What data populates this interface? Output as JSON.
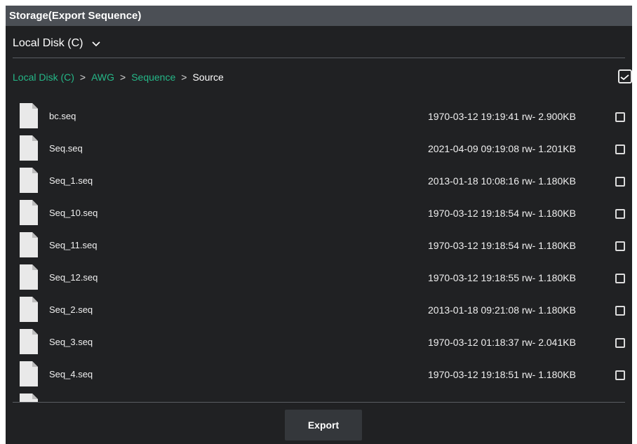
{
  "window": {
    "title": "Storage(Export Sequence)"
  },
  "disk_selector": {
    "value": "Local Disk (C)",
    "icon": "chevron-down-icon"
  },
  "breadcrumb": {
    "items": [
      {
        "label": "Local Disk (C)",
        "link": true
      },
      {
        "label": "AWG",
        "link": true
      },
      {
        "label": "Sequence",
        "link": true
      },
      {
        "label": "Source",
        "link": false
      }
    ],
    "separator": ">"
  },
  "select_all": {
    "checked": true
  },
  "files": [
    {
      "name": "bc.seq",
      "meta": "1970-03-12 19:19:41 rw- 2.900KB",
      "checked": false
    },
    {
      "name": "Seq.seq",
      "meta": "2021-04-09 09:19:08 rw- 1.201KB",
      "checked": false
    },
    {
      "name": "Seq_1.seq",
      "meta": "2013-01-18 10:08:16 rw- 1.180KB",
      "checked": false
    },
    {
      "name": "Seq_10.seq",
      "meta": "1970-03-12 19:18:54 rw- 1.180KB",
      "checked": false
    },
    {
      "name": "Seq_11.seq",
      "meta": "1970-03-12 19:18:54 rw- 1.180KB",
      "checked": false
    },
    {
      "name": "Seq_12.seq",
      "meta": "1970-03-12 19:18:55 rw- 1.180KB",
      "checked": false
    },
    {
      "name": "Seq_2.seq",
      "meta": "2013-01-18 09:21:08 rw- 1.180KB",
      "checked": false
    },
    {
      "name": "Seq_3.seq",
      "meta": "1970-03-12 01:18:37 rw- 2.041KB",
      "checked": false
    },
    {
      "name": "Seq_4.seq",
      "meta": "1970-03-12 19:18:51 rw- 1.180KB",
      "checked": false
    }
  ],
  "footer": {
    "export_label": "Export"
  },
  "colors": {
    "background": "#202123",
    "titlebar": "#4b4f55",
    "link": "#25b888",
    "button": "#34373b"
  }
}
